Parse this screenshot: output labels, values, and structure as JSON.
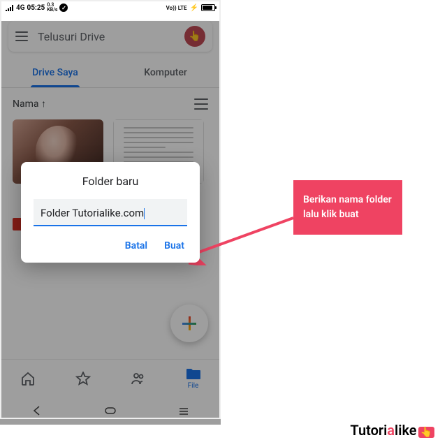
{
  "status": {
    "time": "05:25",
    "net": "4G",
    "speed": "0.3",
    "speed_unit": "KB/s",
    "volte": "Vo)) LTE"
  },
  "search": {
    "placeholder": "Telusuri Drive",
    "avatar_glyph": "👆"
  },
  "tabs": {
    "mydrive": "Drive Saya",
    "computer": "Komputer"
  },
  "sort": {
    "label": "Nama  ↑"
  },
  "dialog": {
    "title": "Folder baru",
    "input_value": "Folder Tutorialike.com",
    "cancel": "Batal",
    "create": "Buat"
  },
  "bottom": {
    "file_label": "File"
  },
  "callout": {
    "text": "Berikan nama folder lalu klik buat"
  },
  "watermark": {
    "pre": "Tutori",
    "accent": "a",
    "post": "like"
  }
}
